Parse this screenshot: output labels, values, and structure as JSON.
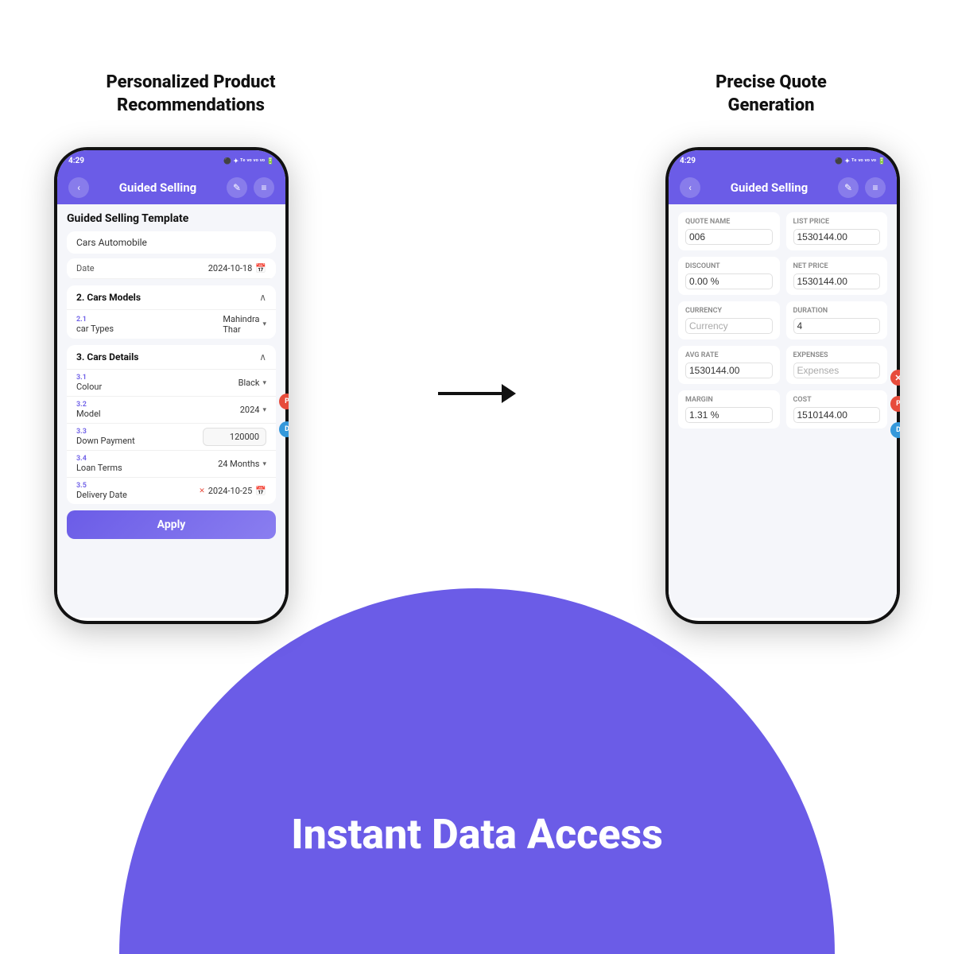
{
  "page": {
    "background": "#ffffff"
  },
  "left_section": {
    "title": "Personalized Product\nRecommendations"
  },
  "right_section": {
    "title": "Precise Quote\nGeneration"
  },
  "bottom_text": "Instant Data Access",
  "left_phone": {
    "status_bar": {
      "time": "4:29",
      "icons": "● ···"
    },
    "header": {
      "title": "Guided Selling",
      "back_icon": "‹",
      "edit_icon": "✎",
      "clipboard_icon": "📋"
    },
    "template_title": "Guided Selling Template",
    "cars_auto": "Cars  Automobile",
    "date_label": "Date",
    "date_value": "2024-10-18",
    "section2": {
      "number": "2.",
      "title": "Cars Models",
      "fields": [
        {
          "num": "2.1",
          "label": "car Types",
          "value": "Mahindra\nThar",
          "has_dropdown": true
        }
      ]
    },
    "section3": {
      "number": "3.",
      "title": "Cars Details",
      "fields": [
        {
          "num": "3.1",
          "label": "Colour",
          "value": "Black",
          "has_dropdown": true
        },
        {
          "num": "3.2",
          "label": "Model",
          "value": "2024",
          "has_dropdown": true
        },
        {
          "num": "3.3",
          "label": "Down Payment",
          "value": "120000",
          "has_dropdown": false
        },
        {
          "num": "3.4",
          "label": "Loan Terms",
          "value": "24 Months",
          "has_dropdown": true
        },
        {
          "num": "3.5",
          "label": "Delivery Date",
          "value": "2024-10-25",
          "has_date_icon": true
        }
      ]
    },
    "apply_button": "Apply",
    "notifications": [
      {
        "color": "red",
        "label": "P",
        "position": "right-top"
      },
      {
        "color": "blue",
        "label": "D",
        "position": "right-mid"
      }
    ]
  },
  "right_phone": {
    "status_bar": {
      "time": "4:29",
      "icons": "● ···"
    },
    "header": {
      "title": "Guided Selling",
      "back_icon": "‹",
      "edit_icon": "✎",
      "clipboard_icon": "📋"
    },
    "fields": [
      {
        "label": "QUOTE Name",
        "value": "006",
        "position": "left"
      },
      {
        "label": "LIST PRICE",
        "value": "1530144.00",
        "position": "right"
      },
      {
        "label": "DISCOUNT",
        "value": "0.00 %",
        "position": "left"
      },
      {
        "label": "NET PRICE",
        "value": "1530144.00",
        "position": "right"
      },
      {
        "label": "CURRENCY",
        "value": "Currency",
        "position": "left"
      },
      {
        "label": "DURATION",
        "value": "4",
        "position": "right"
      },
      {
        "label": "AVG RATE",
        "value": "1530144.00",
        "position": "left"
      },
      {
        "label": "EXPENSES",
        "value": "Expenses",
        "position": "right"
      },
      {
        "label": "MARGIN",
        "value": "1.31 %",
        "position": "left"
      },
      {
        "label": "COST",
        "value": "1510144.00",
        "position": "right"
      }
    ],
    "notifications": [
      {
        "color": "red",
        "label": "P",
        "position": "right-top"
      },
      {
        "color": "blue",
        "label": "D",
        "position": "right-mid"
      }
    ]
  }
}
